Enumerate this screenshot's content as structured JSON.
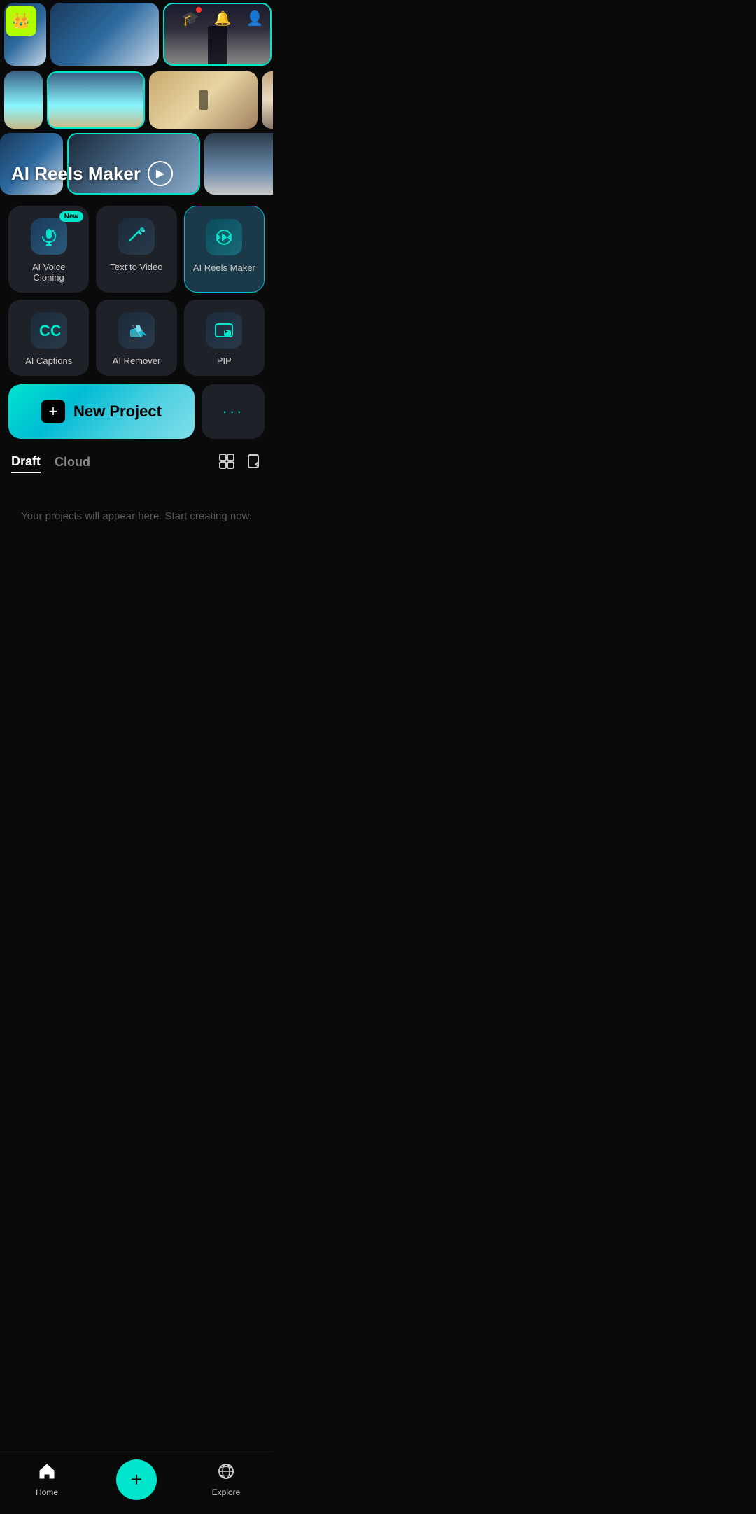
{
  "header": {
    "crown_icon": "👑",
    "graduation_icon": "🎓",
    "notification_icon": "🔔",
    "profile_icon": "👤",
    "has_notification": true
  },
  "thumbnails": {
    "row1": [
      {
        "fill": "fill-boat",
        "selected": false
      },
      {
        "fill": "fill-boat",
        "selected": false
      },
      {
        "fill": "fill-dark-figure",
        "selected": true
      },
      {
        "fill": "fill-outdoor",
        "selected": false
      }
    ],
    "row2": [
      {
        "fill": "fill-beach",
        "selected": false
      },
      {
        "fill": "fill-beach",
        "selected": true
      },
      {
        "fill": "fill-desert",
        "selected": false
      },
      {
        "fill": "fill-building",
        "selected": false
      }
    ],
    "row3": [
      {
        "fill": "fill-boat",
        "selected": false
      },
      {
        "fill": "fill-harbor",
        "selected": true
      },
      {
        "fill": "fill-pier",
        "selected": false
      },
      {
        "fill": "fill-terrace",
        "selected": false
      }
    ]
  },
  "reels_title": "AI Reels Maker",
  "play_icon": "▶",
  "tools": [
    {
      "id": "voice-cloning",
      "label": "AI Voice Cloning",
      "icon_class": "icon-voice",
      "icon_char": "🎙",
      "is_new": true,
      "is_active": false
    },
    {
      "id": "text-to-video",
      "label": "Text to Video",
      "icon_class": "icon-t2v",
      "icon_char": "✏",
      "is_new": false,
      "is_active": false
    },
    {
      "id": "reels-maker",
      "label": "AI Reels Maker",
      "icon_class": "icon-reels",
      "icon_char": "⚡",
      "is_new": false,
      "is_active": true
    },
    {
      "id": "captions",
      "label": "AI Captions",
      "icon_class": "icon-captions",
      "icon_char": "CC",
      "is_new": false,
      "is_active": false
    },
    {
      "id": "remover",
      "label": "AI Remover",
      "icon_class": "icon-remover",
      "icon_char": "🧹",
      "is_new": false,
      "is_active": false
    },
    {
      "id": "pip",
      "label": "PIP",
      "icon_class": "icon-pip",
      "icon_char": "▶",
      "is_new": false,
      "is_active": false
    }
  ],
  "new_badge_label": "New",
  "new_project_label": "New Project",
  "more_dots": "···",
  "tabs": [
    {
      "label": "Draft",
      "active": true
    },
    {
      "label": "Cloud",
      "active": false
    }
  ],
  "empty_state_text": "Your projects will appear here. Start creating now.",
  "bottom_nav": [
    {
      "id": "home",
      "icon": "🏠",
      "label": "Home",
      "active": true
    },
    {
      "id": "create",
      "icon": "+",
      "label": "",
      "is_center": true
    },
    {
      "id": "explore",
      "icon": "🪐",
      "label": "Explore",
      "active": false
    }
  ]
}
